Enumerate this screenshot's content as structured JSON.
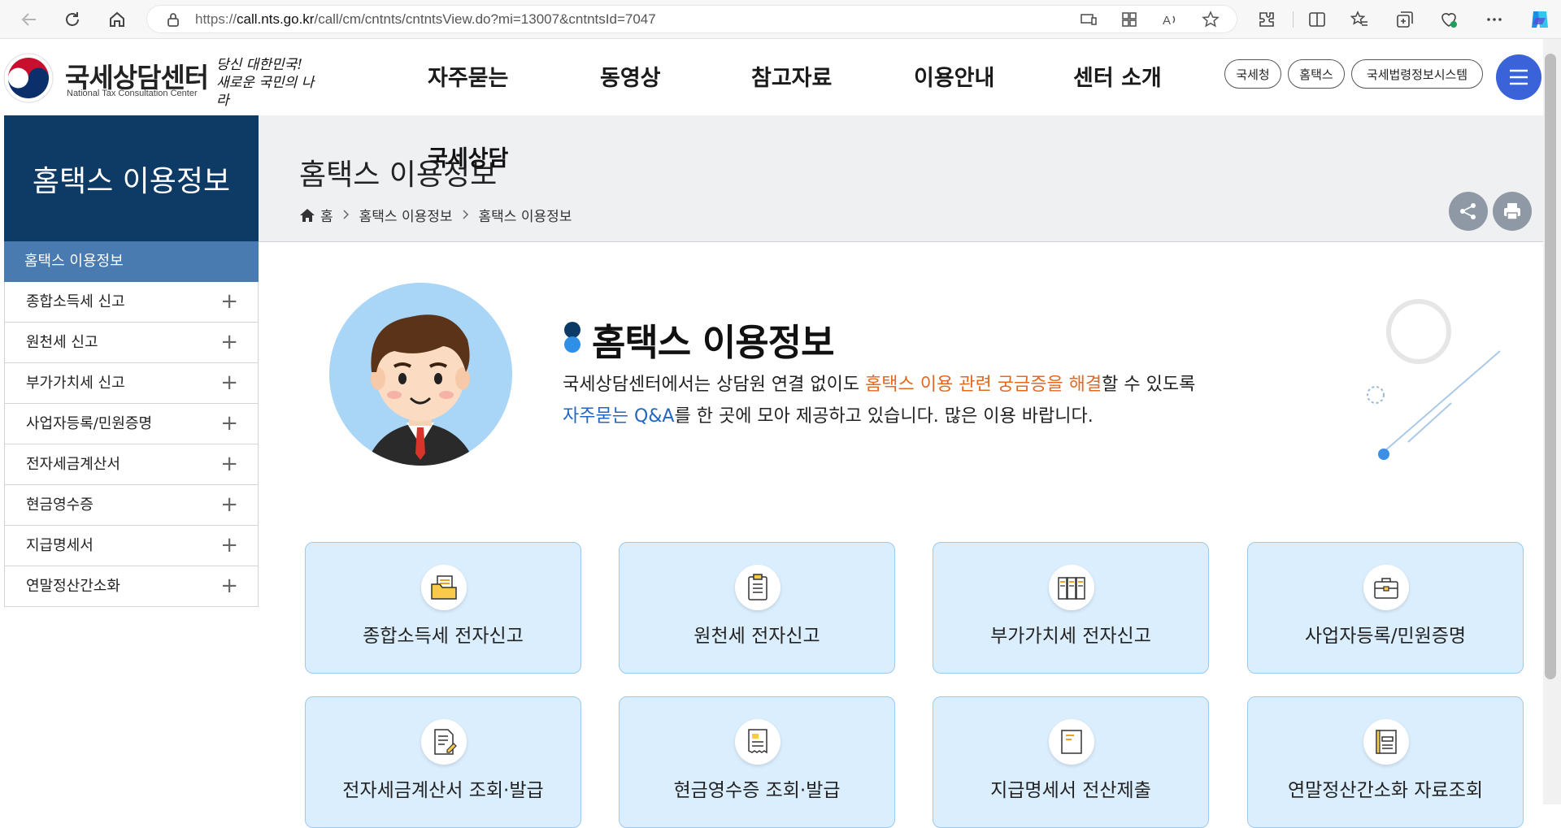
{
  "browser": {
    "url_prefix": "https://",
    "url_domain": "call.nts.go.kr",
    "url_path": "/call/cm/cntnts/cntntsView.do?mi=13007&cntntsId=7047"
  },
  "site": {
    "logo_title": "국세상담센터",
    "logo_subtitle": "National Tax Consultation Center",
    "logo_slogan_1": "당신 대한민국!",
    "logo_slogan_2": "새로운 국민의 나라",
    "gnb": [
      "자주묻는",
      "동영상",
      "참고자료",
      "이용안내",
      "센터 소개"
    ],
    "gnb_overlay": "국세상담",
    "quick_links": [
      "국세청",
      "홈택스",
      "국세법령정보시스템"
    ]
  },
  "sidebar": {
    "title": "홈택스 이용정보",
    "active": "홈택스 이용정보",
    "items": [
      "종합소득세 신고",
      "원천세 신고",
      "부가가치세 신고",
      "사업자등록/민원증명",
      "전자세금계산서",
      "현금영수증",
      "지급명세서",
      "연말정산간소화"
    ],
    "expand_glyph": "+"
  },
  "page": {
    "title": "홈택스 이용정보",
    "breadcrumb": [
      "홈",
      "홈택스 이용정보",
      "홈택스 이용정보"
    ]
  },
  "intro": {
    "heading": "홈택스 이용정보",
    "text_1a": "국세상담센터에서는 상담원 연결 없이도 ",
    "text_1b": "홈택스 이용 관련 궁금증을 해결",
    "text_1c": "할 수 있도록",
    "text_2a": "자주묻는 Q&A",
    "text_2b": "를 한 곳에 모아 제공하고 있습니다. 많은 이용 바랍니다."
  },
  "cards": [
    {
      "label": "종합소득세 전자신고",
      "icon": "folder-document-icon"
    },
    {
      "label": "원천세 전자신고",
      "icon": "clipboard-icon"
    },
    {
      "label": "부가가치세 전자신고",
      "icon": "binders-icon"
    },
    {
      "label": "사업자등록/민원증명",
      "icon": "briefcase-icon"
    },
    {
      "label": "전자세금계산서 조회·발급",
      "icon": "invoice-edit-icon"
    },
    {
      "label": "현금영수증 조회·발급",
      "icon": "receipt-icon"
    },
    {
      "label": "지급명세서 전산제출",
      "icon": "statement-icon"
    },
    {
      "label": "연말정산간소화 자료조회",
      "icon": "ledger-icon"
    }
  ],
  "colors": {
    "sidebar_head": "#0e3a66",
    "sidebar_active": "#4a7bb0",
    "card_bg": "#dbeefd",
    "card_border": "#9dc9ee",
    "highlight_orange": "#e4681e",
    "highlight_blue": "#2167c2",
    "menu_button": "#3b63d9"
  }
}
